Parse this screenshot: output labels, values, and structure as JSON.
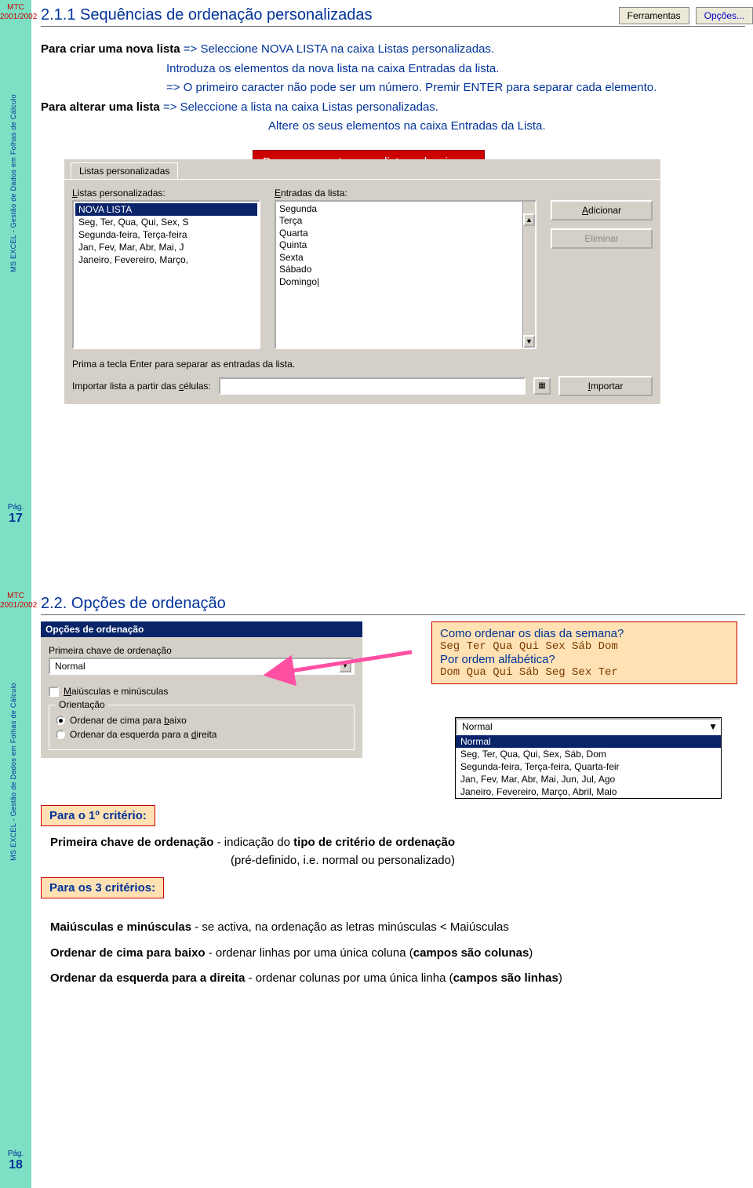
{
  "slide1": {
    "mtc": "MTC",
    "year": "2001/2002",
    "side_text": "MS EXCEL - Gestão de Dados em Folhas de Cálculo",
    "page_label": "Pág.",
    "page_num": "17",
    "title": "2.1.1 Sequências de ordenação personalizadas",
    "menu_ferramentas": "Ferramentas",
    "menu_opcoes": "Opções...",
    "p1_a": "Para criar uma nova lista",
    "p1_b": " => Seleccione NOVA LISTA na caixa Listas personalizadas.",
    "p2": "Introduza os elementos da nova lista na caixa Entradas da lista.",
    "p3": "=> O primeiro caracter não pode ser um número. Premir ENTER para separar cada elemento.",
    "p4_a": "Para alterar uma lista",
    "p4_b": " => Seleccione a lista na caixa Listas personalizadas.",
    "p5": "Altere os seus elementos na caixa Entradas da Lista.",
    "callout": "Para acrescentar nova lista, seleccionar:",
    "dialog": {
      "tab": "Listas personalizadas",
      "lbl_listas": "Listas personalizadas:",
      "lbl_entradas": "Entradas da lista:",
      "listas": [
        "NOVA LISTA",
        "Seg, Ter, Qua, Qui, Sex, S",
        "Segunda-feira, Terça-feira",
        "Jan, Fev, Mar, Abr, Mai, J",
        "Janeiro, Fevereiro, Março,"
      ],
      "entradas": "Segunda\nTerça\nQuarta\nQuinta\nSexta\nSábado\nDomingo|",
      "btn_add": "Adicionar",
      "btn_del": "Eliminar",
      "hint": "Prima a tecla Enter para separar as entradas da lista.",
      "import_lbl": "Importar lista a partir das células:",
      "btn_import": "Importar"
    }
  },
  "slide2": {
    "mtc": "MTC",
    "year": "2001/2002",
    "side_text": "MS EXCEL - Gestão de Dados em Folhas de Cálculo",
    "page_label": "Pág.",
    "page_num": "18",
    "title": "2.2. Opções de ordenação",
    "opts_dialog": {
      "title": "Opções de ordenação",
      "lbl_primeira": "Primeira chave de ordenação",
      "combo_val": "Normal",
      "chk_maiusc": "Maiúsculas e minúsculas",
      "grp_orient": "Orientação",
      "rad_cima": "Ordenar de cima para baixo",
      "rad_esq": "Ordenar da esquerda para a direita"
    },
    "orange_box": {
      "l1": "Como ordenar os dias da semana?",
      "l2": "Seg Ter Qua Qui Sex Sáb Dom",
      "l3": "Por ordem alfabética?",
      "l4": "Dom Qua Qui Sáb Seg Sex Ter"
    },
    "dropdown": {
      "combo_val": "Normal",
      "opts": [
        "Normal",
        "Seg, Ter, Qua, Qui, Sex, Sáb, Dom",
        "Segunda-feira, Terça-feira, Quarta-feir",
        "Jan, Fev, Mar, Abr, Mai, Jun, Jul, Ago",
        "Janeiro, Fevereiro, Março, Abril, Maio"
      ]
    },
    "callout1": "Para o 1º critério:",
    "body1_a": "Primeira chave de ordenação",
    "body1_b": " - indicação do ",
    "body1_c": "tipo de critério de ordenação",
    "body1_d": "(pré-definido, i.e. normal ou personalizado)",
    "callout2": "Para os 3 critérios:",
    "line_m_a": "Maiúsculas e  minúsculas",
    "line_m_b": " - se activa, na ordenação as letras minúsculas < Maiúsculas",
    "line_c_a": "Ordenar de cima para baixo",
    "line_c_b": " - ordenar linhas por uma única coluna (",
    "line_c_c": "campos são colunas",
    "line_c_d": ")",
    "line_e_a": "Ordenar da esquerda para a direita",
    "line_e_b": " - ordenar colunas por uma única linha (",
    "line_e_c": "campos são linhas",
    "line_e_d": ")"
  }
}
